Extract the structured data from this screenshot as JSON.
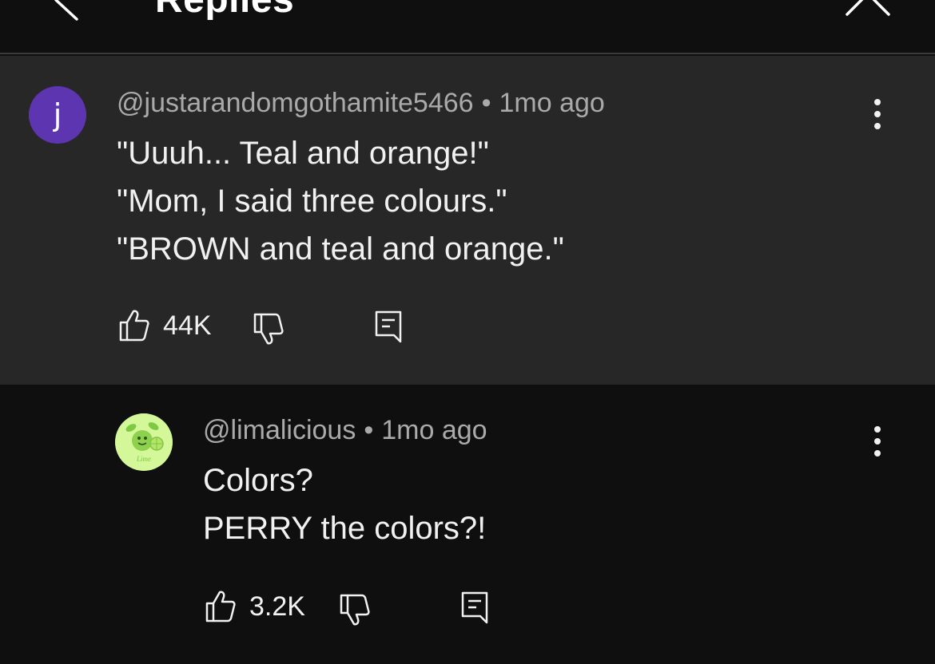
{
  "header": {
    "title": "Replies"
  },
  "parent_comment": {
    "avatar_letter": "j",
    "author": "@justarandomgothamite5466",
    "separator": "•",
    "time": "1mo ago",
    "lines": [
      "\"Uuuh... Teal and orange!\"",
      "\"Mom, I said three colours.\"",
      "\"BROWN and teal and orange.\""
    ],
    "likes": "44K"
  },
  "reply_comment": {
    "avatar_text": "Lime",
    "author": "@limalicious",
    "separator": "•",
    "time": "1mo ago",
    "lines": [
      "Colors?",
      "PERRY the colors?!"
    ],
    "likes": "3.2K"
  },
  "icons": {
    "back": "chevron-left-icon",
    "close": "close-icon",
    "more": "more-vertical-icon",
    "like": "thumbs-up-icon",
    "dislike": "thumbs-down-icon",
    "reply": "comment-icon"
  },
  "colors": {
    "background": "#0f0f0f",
    "parent_background": "#272727",
    "avatar_purple": "#5e35b1",
    "avatar_lime": "#d4f79a",
    "meta_text": "#aaaaaa",
    "body_text": "#f1f1f1"
  }
}
